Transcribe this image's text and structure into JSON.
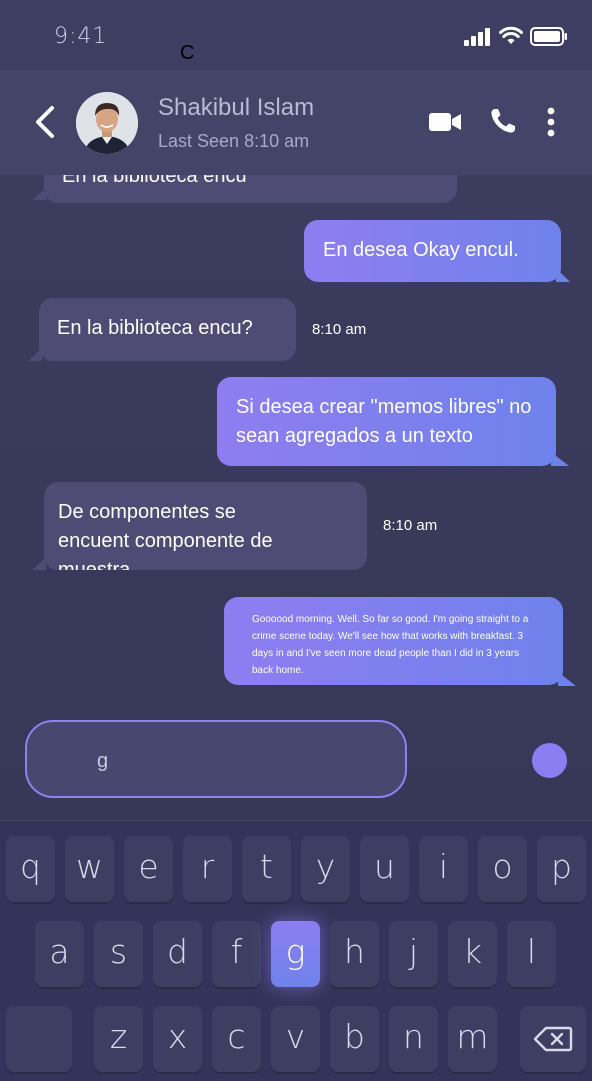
{
  "status_bar": {
    "time": "9:41",
    "stray_char": "C"
  },
  "header": {
    "contact_name": "Shakibul Islam",
    "last_seen": "Last Seen 8:10 am",
    "icons": [
      "back-arrow-icon",
      "avatar",
      "video-call-icon",
      "phone-icon",
      "more-vertical-icon"
    ]
  },
  "messages": [
    {
      "dir": "in",
      "text": "En la biblioteca encu"
    },
    {
      "dir": "out",
      "text": "En desea Okay encul."
    },
    {
      "dir": "in",
      "text": "En la biblioteca encu?",
      "time": "8:10 am"
    },
    {
      "dir": "out",
      "text": "Si desea crear \"memos libres\" no sean agregados a un texto"
    },
    {
      "dir": "in",
      "text": "De componentes se encuent componente de muestra",
      "time": "8:10 am"
    },
    {
      "dir": "out",
      "text": "Goooood morning. Well. So far so good. I'm going straight to a crime scene today. We'll see how that works with breakfast. 3 days in and I've seen more dead people than I did in 3 years back home."
    }
  ],
  "composer": {
    "value": "g",
    "send_icon": "send-dot-icon"
  },
  "keyboard": {
    "row1": [
      "q",
      "w",
      "e",
      "r",
      "t",
      "y",
      "u",
      "i",
      "o",
      "p"
    ],
    "row2": [
      "a",
      "s",
      "d",
      "f",
      "g",
      "h",
      "j",
      "k",
      "l"
    ],
    "row3": [
      "z",
      "x",
      "c",
      "v",
      "b",
      "n",
      "m"
    ],
    "active_key": "g",
    "icons": [
      "shift-key",
      "backspace-icon"
    ]
  },
  "colors": {
    "accent": "#8b7ef1",
    "background": "#3a3a5c",
    "incoming_bubble": "#4e4c74"
  }
}
